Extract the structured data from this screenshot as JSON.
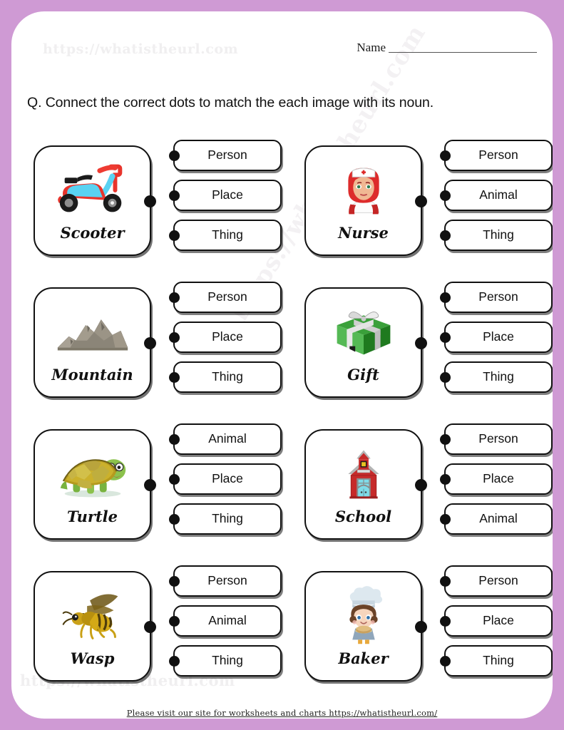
{
  "page": {
    "border_color": "#cf9ad4",
    "sheet_color": "#ffffff",
    "watermark_top": "https://whatistheurl.com",
    "watermark_bottom": "https://whatistheurl.com",
    "watermark_diagonal": "https://whatistheurl.com"
  },
  "header": {
    "name_label": "Name",
    "name_value": ""
  },
  "question": "Q. Connect the correct dots to match the each image with its noun.",
  "items": [
    {
      "word": "Scooter",
      "icon": "scooter-icon",
      "options": [
        "Person",
        "Place",
        "Thing"
      ]
    },
    {
      "word": "Nurse",
      "icon": "nurse-icon",
      "options": [
        "Person",
        "Animal",
        "Thing"
      ]
    },
    {
      "word": "Mountain",
      "icon": "mountain-icon",
      "options": [
        "Person",
        "Place",
        "Thing"
      ]
    },
    {
      "word": "Gift",
      "icon": "gift-icon",
      "options": [
        "Person",
        "Place",
        "Thing"
      ]
    },
    {
      "word": "Turtle",
      "icon": "turtle-icon",
      "options": [
        "Animal",
        "Place",
        "Thing"
      ]
    },
    {
      "word": "School",
      "icon": "school-icon",
      "options": [
        "Person",
        "Place",
        "Animal"
      ]
    },
    {
      "word": "Wasp",
      "icon": "wasp-icon",
      "options": [
        "Person",
        "Animal",
        "Thing"
      ]
    },
    {
      "word": "Baker",
      "icon": "baker-icon",
      "options": [
        "Person",
        "Place",
        "Thing"
      ]
    }
  ],
  "footer": {
    "text": "Please visit our site for worksheets  and charts https://whatistheurl.com/"
  }
}
